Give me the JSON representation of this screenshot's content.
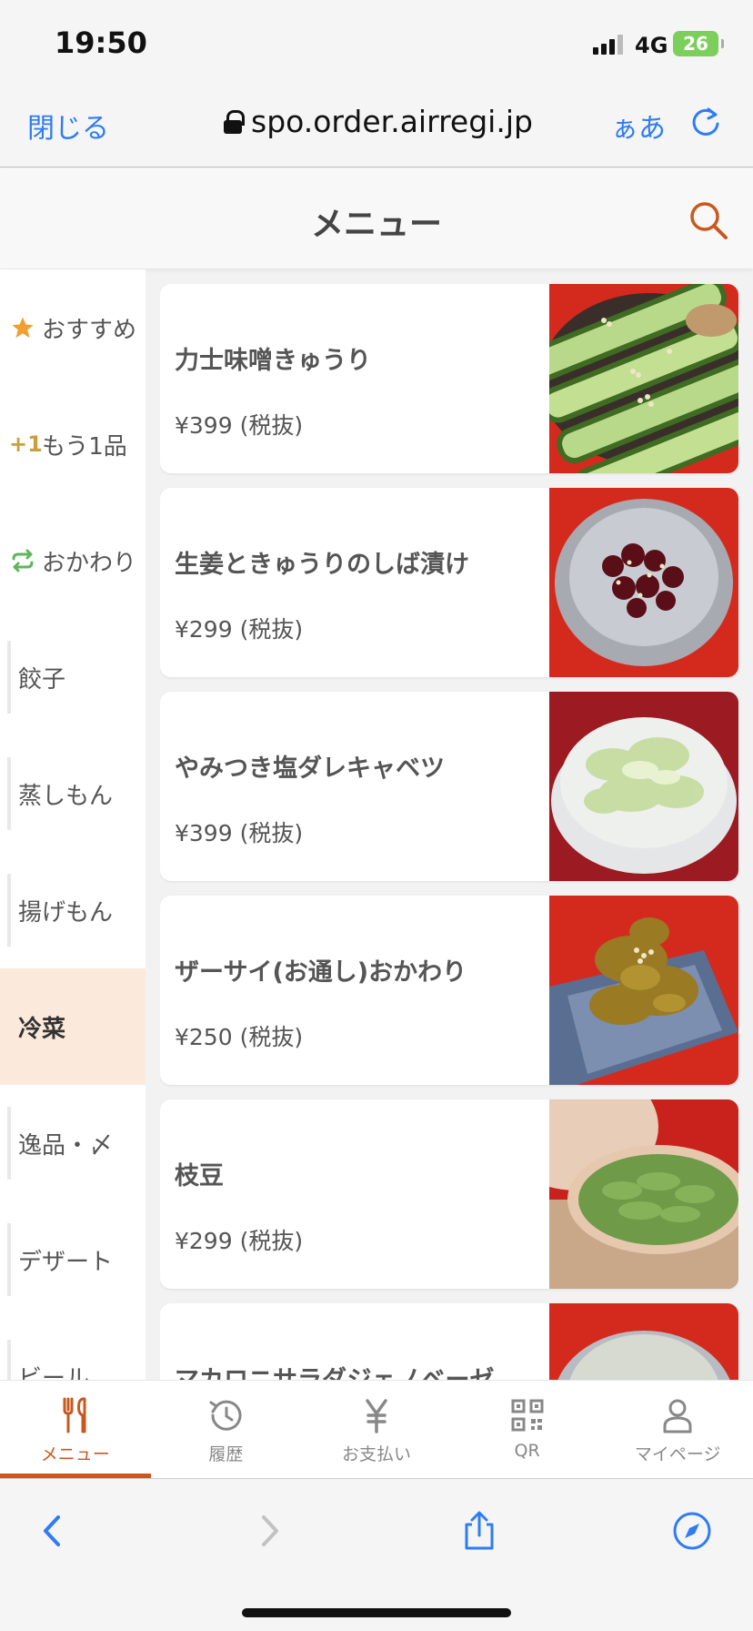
{
  "status_bar": {
    "time": "19:50",
    "network": "4G",
    "battery": "26"
  },
  "browser": {
    "close_label": "閉じる",
    "url": "spo.order.airregi.jp",
    "text_size_label": "ぁあ"
  },
  "header": {
    "title": "メニュー"
  },
  "sidebar": {
    "items": [
      {
        "label": "おすすめ",
        "icon": "star-icon",
        "icon_color": "#f0a030"
      },
      {
        "label": "もう1品",
        "icon_text": "+1",
        "icon": "plus-one-icon",
        "icon_color": "#c8a040"
      },
      {
        "label": "おかわり",
        "icon": "refill-icon",
        "icon_color": "#5cb85c"
      },
      {
        "label": "餃子"
      },
      {
        "label": "蒸しもん"
      },
      {
        "label": "揚げもん"
      },
      {
        "label": "冷菜",
        "active": true
      },
      {
        "label": "逸品・〆"
      },
      {
        "label": "デザート"
      },
      {
        "label": "ビール"
      }
    ]
  },
  "menu": {
    "items": [
      {
        "name": "力士味噌きゅうり",
        "price": "¥399 (税抜)",
        "photo": "cucumber-miso-photo"
      },
      {
        "name": "生姜ときゅうりのしば漬け",
        "price": "¥299 (税抜)",
        "photo": "shibazuke-photo"
      },
      {
        "name": "やみつき塩ダレキャベツ",
        "price": "¥399 (税抜)",
        "photo": "cabbage-photo"
      },
      {
        "name": "ザーサイ(お通し)おかわり",
        "price": "¥250 (税抜)",
        "photo": "zha-cai-photo"
      },
      {
        "name": "枝豆",
        "price": "¥299 (税抜)",
        "photo": "edamame-photo"
      },
      {
        "name": "マカロニサラダジェノベーゼ",
        "price": "",
        "photo": "macaroni-photo"
      }
    ]
  },
  "tabbar": {
    "items": [
      {
        "label": "メニュー",
        "icon": "fork-knife-icon",
        "active": true
      },
      {
        "label": "履歴",
        "icon": "history-icon"
      },
      {
        "label": "お支払い",
        "icon": "yen-icon"
      },
      {
        "label": "QR",
        "icon": "qr-code-icon"
      },
      {
        "label": "マイページ",
        "icon": "person-icon"
      }
    ]
  },
  "colors": {
    "accent": "#c8581e",
    "link_blue": "#2e7cf6",
    "active_category_bg": "#fbeadb",
    "photo_background_red": "#d42a1e"
  }
}
